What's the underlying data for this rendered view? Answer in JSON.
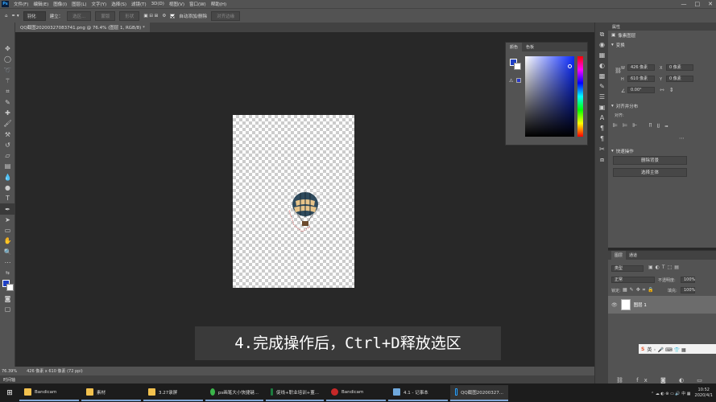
{
  "menubar": {
    "items": [
      "文件(F)",
      "编辑(E)",
      "图像(I)",
      "图层(L)",
      "文字(Y)",
      "选择(S)",
      "滤镜(T)",
      "3D(D)",
      "视图(V)",
      "窗口(W)",
      "帮助(H)"
    ],
    "window_controls": [
      "—",
      "□",
      "✕"
    ]
  },
  "options": {
    "feather_label": "羽化",
    "mode_label": "建立：",
    "selection_btn": "选区...",
    "mask_btn": "蒙版",
    "shape_btn": "形状",
    "auto_add_delete": "自动添加/删除",
    "align_edges": "对齐边缘"
  },
  "document": {
    "tab_title": "QQ截图20200327083741.png @ 76.4% (图层 1, RGB/8) *"
  },
  "status": {
    "zoom": "76.39%",
    "size": "426 像素 x 610 像素 (72 ppi)"
  },
  "timeline": {
    "label": "时间轴"
  },
  "subtitle": {
    "text": "4.完成操作后，Ctrl+D释放选区"
  },
  "color_panel": {
    "tabs": [
      "颜色",
      "色板"
    ],
    "fg_color": "#1f3fc4",
    "bg_color": "#ffffff"
  },
  "properties": {
    "panel_title": "属性",
    "pixel_layer": "像素图层",
    "transform_title": "变换",
    "w_label": "W",
    "w_value": "426 像素",
    "x_label": "X",
    "x_value": "0 像素",
    "h_label": "H",
    "h_value": "610 像素",
    "y_label": "Y",
    "y_value": "0 像素",
    "angle": "0.00°",
    "align_title": "对齐并分布",
    "align_sub": "对齐:",
    "quick_title": "快速操作",
    "remove_bg": "删除背景",
    "select_subject": "选择主体"
  },
  "layers": {
    "tabs": [
      "图层",
      "通道"
    ],
    "filter": "类型",
    "blend": "正常",
    "opacity_label": "不透明度:",
    "opacity": "100%",
    "lock_label": "锁定:",
    "fill_label": "填充:",
    "fill": "100%",
    "layer_name": "图层 1"
  },
  "taskbar": {
    "items": [
      {
        "label": "Bandicam",
        "color": "#f2c14e"
      },
      {
        "label": "素材",
        "color": "#f2c14e"
      },
      {
        "label": "3.27录屏",
        "color": "#f2c14e"
      },
      {
        "label": "ps画笔大小快捷键...",
        "color": "#3bb54a"
      },
      {
        "label": "促线+职业培训+董...",
        "color": "#1d7a3e"
      },
      {
        "label": "Bandicam",
        "color": "#c62828"
      },
      {
        "label": "4.1 - 记事本",
        "color": "#6fa8dc"
      },
      {
        "label": "QQ截图20200327...",
        "color": "#0a1e3c"
      }
    ],
    "time": "10:52",
    "date": "2020/4/1"
  }
}
